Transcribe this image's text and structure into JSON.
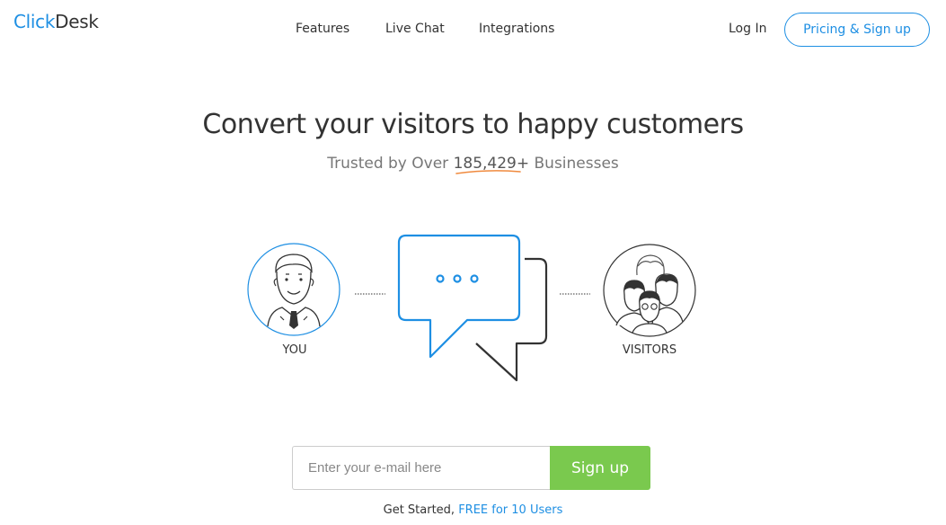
{
  "brand": {
    "part1": "Click",
    "part2": "Desk"
  },
  "nav": {
    "features": "Features",
    "live_chat": "Live Chat",
    "integrations": "Integrations",
    "login": "Log In",
    "pricing_signup": "Pricing & Sign up"
  },
  "hero": {
    "title": "Convert your visitors to happy customers",
    "subtitle_prefix": "Trusted by Over ",
    "subtitle_count": "185,429+",
    "subtitle_suffix": " Businesses"
  },
  "illustration": {
    "you_label": "YOU",
    "visitors_label": "VISITORS",
    "accent_color": "#1e8fe3",
    "icons": [
      "agent-avatar-icon",
      "chat-bubble-icon",
      "visitors-group-icon"
    ]
  },
  "signup": {
    "email_placeholder": "Enter your e-mail here",
    "email_value": "",
    "button_label": "Sign up",
    "button_color": "#7ac94e"
  },
  "footer": {
    "prefix": "Get Started, ",
    "link": "FREE for 10 Users"
  }
}
